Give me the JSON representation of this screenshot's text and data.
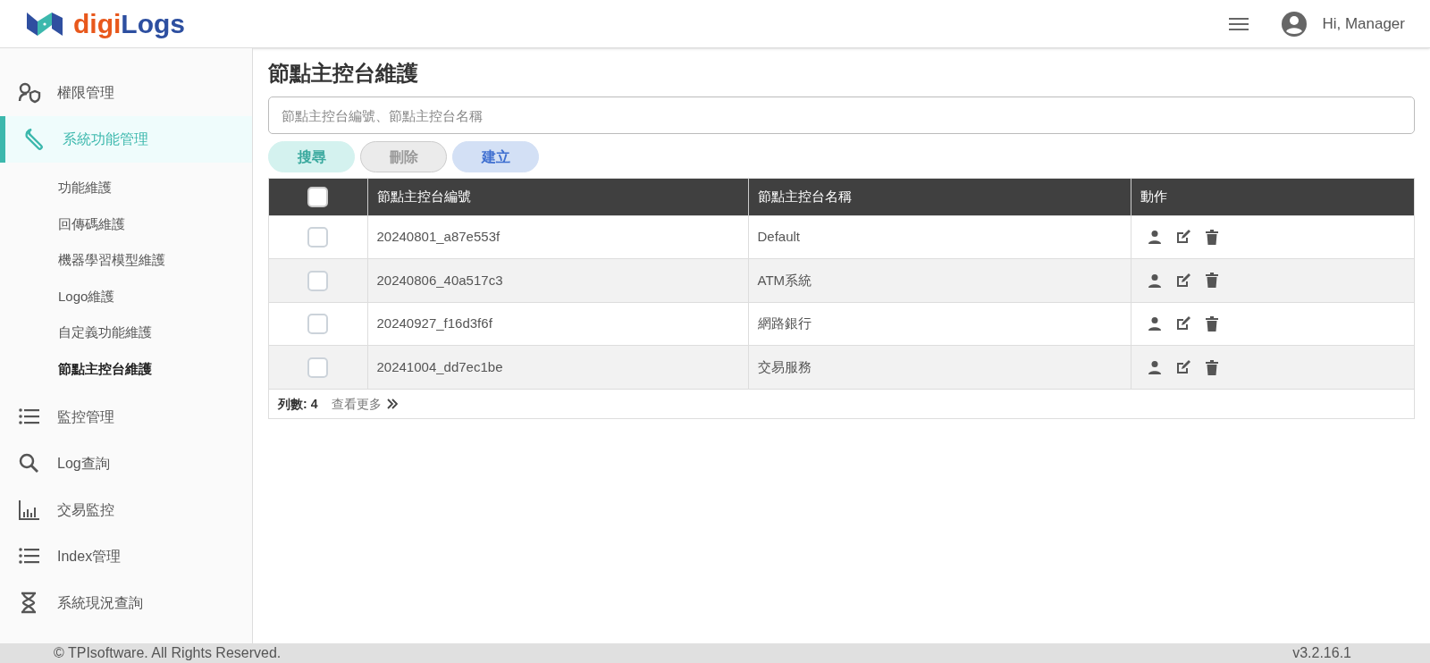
{
  "header": {
    "logo": {
      "first": "digi",
      "second": "Logs"
    },
    "greeting": "Hi, Manager"
  },
  "sidebar": {
    "items": [
      {
        "label": "權限管理",
        "kind": "people",
        "selected": false
      },
      {
        "label": "系統功能管理",
        "kind": "wrench",
        "selected": true,
        "expanded": true,
        "children": [
          {
            "label": "功能維護",
            "selected": false
          },
          {
            "label": "回傳碼維護",
            "selected": false
          },
          {
            "label": "機器學習模型維護",
            "selected": false
          },
          {
            "label": "Logo維護",
            "selected": false
          },
          {
            "label": "自定義功能維護",
            "selected": false
          },
          {
            "label": "節點主控台維護",
            "selected": true
          }
        ]
      },
      {
        "label": "監控管理",
        "kind": "list",
        "selected": false
      },
      {
        "label": "Log查詢",
        "kind": "search",
        "selected": false
      },
      {
        "label": "交易監控",
        "kind": "chart",
        "selected": false
      },
      {
        "label": "Index管理",
        "kind": "list",
        "selected": false
      },
      {
        "label": "系統現況查詢",
        "kind": "hourglass",
        "selected": false
      }
    ]
  },
  "page_title": "節點主控台維護",
  "search": {
    "placeholder": "節點主控台編號、節點主控台名稱"
  },
  "buttons": [
    {
      "label": "搜尋",
      "kind": "search",
      "disabled": false
    },
    {
      "label": "刪除",
      "kind": "delete",
      "disabled": true
    },
    {
      "label": "建立",
      "kind": "create",
      "disabled": false
    }
  ],
  "table": {
    "select_all_checked": false,
    "columns": [
      "節點主控台編號",
      "節點主控台名稱",
      "動作"
    ],
    "rows": [
      {
        "checked": false,
        "id": "20240801_a87e553f",
        "name": "Default"
      },
      {
        "checked": false,
        "id": "20240806_40a517c3",
        "name": "ATM系統"
      },
      {
        "checked": false,
        "id": "20240927_f16d3f6f",
        "name": "網路銀行"
      },
      {
        "checked": false,
        "id": "20241004_dd7ec1be",
        "name": "交易服務"
      }
    ],
    "row_count_label": "列數:",
    "row_count": "4",
    "more_link": "查看更多"
  },
  "footer": {
    "copyright": "© TPIsoftware. All Rights Reserved.",
    "version": "v3.2.16.1"
  }
}
